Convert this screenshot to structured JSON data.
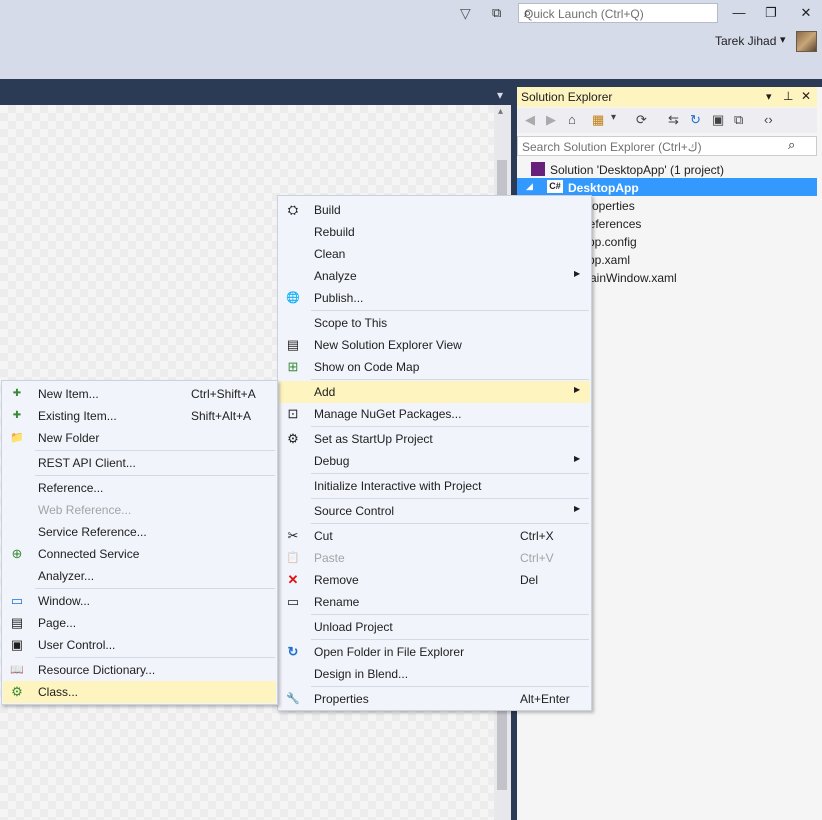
{
  "titlebar": {
    "quick_launch_placeholder": "Quick Launch (Ctrl+Q)",
    "user_name": "Tarek Jihad",
    "filter_glyph": "▽",
    "feedback_glyph": "⧉",
    "search_glyph": "⌕",
    "minimize_glyph": "—",
    "restore_glyph": "❐",
    "close_glyph": "✕",
    "dropdown_glyph": "▾"
  },
  "designer": {
    "dropdown_glyph": "▾",
    "scroll_up_glyph": "▴"
  },
  "solution_explorer": {
    "title": "Solution Explorer",
    "title_glyphs": {
      "dropdown": "▾",
      "pin": "⊥",
      "close": "✕"
    },
    "toolbar_glyphs": [
      "◀",
      "▶",
      "⌂",
      "▦",
      "▾",
      "⟳",
      "⇆",
      "↻",
      "▣",
      "⧉",
      "‹›"
    ],
    "search_placeholder": "Search Solution Explorer (Ctrl+ك)",
    "search_glyph": "⌕",
    "tree": {
      "solution": "Solution 'DesktopApp' (1 project)",
      "project": "DesktopApp",
      "project_badge": "C#",
      "expand_glyph": "◢",
      "children": [
        "Properties",
        "References",
        "App.config",
        "App.xaml",
        "MainWindow.xaml"
      ]
    }
  },
  "project_menu": {
    "items": [
      {
        "label": "Build",
        "icon": "build-icon",
        "glyph": "⛭"
      },
      {
        "label": "Rebuild"
      },
      {
        "label": "Clean"
      },
      {
        "label": "Analyze",
        "submenu": true
      },
      {
        "label": "Publish...",
        "icon": "globe-icon",
        "glyph": "🌐"
      },
      {
        "label": "Scope to This"
      },
      {
        "label": "New Solution Explorer View",
        "icon": "new-view-icon",
        "glyph": "▤"
      },
      {
        "label": "Show on Code Map",
        "icon": "code-map-icon",
        "glyph": "⊞"
      },
      {
        "label": "Add",
        "submenu": true,
        "highlighted": true
      },
      {
        "label": "Manage NuGet Packages...",
        "icon": "package-icon",
        "glyph": "⊡"
      },
      {
        "label": "Set as StartUp Project",
        "icon": "gear-icon",
        "glyph": "⚙"
      },
      {
        "label": "Debug",
        "submenu": true
      },
      {
        "label": "Initialize Interactive with Project"
      },
      {
        "label": "Source Control",
        "submenu": true
      },
      {
        "label": "Cut",
        "shortcut": "Ctrl+X",
        "icon": "scissors-icon",
        "glyph": "✂"
      },
      {
        "label": "Paste",
        "shortcut": "Ctrl+V",
        "icon": "paste-icon",
        "glyph": "📋",
        "disabled": true
      },
      {
        "label": "Remove",
        "shortcut": "Del",
        "icon": "remove-icon",
        "glyph": "✕"
      },
      {
        "label": "Rename",
        "icon": "rename-icon",
        "glyph": "▭"
      },
      {
        "label": "Unload Project"
      },
      {
        "label": "Open Folder in File Explorer",
        "icon": "refresh-arrow-icon",
        "glyph": "↻"
      },
      {
        "label": "Design in Blend..."
      },
      {
        "label": "Properties",
        "shortcut": "Alt+Enter",
        "icon": "wrench-icon",
        "glyph": "🔧"
      }
    ],
    "arrow_glyph": "▶"
  },
  "add_menu": {
    "items": [
      {
        "label": "New Item...",
        "shortcut": "Ctrl+Shift+A",
        "icon": "new-item-icon",
        "glyph": "✚"
      },
      {
        "label": "Existing Item...",
        "shortcut": "Shift+Alt+A",
        "icon": "existing-item-icon",
        "glyph": "✚"
      },
      {
        "label": "New Folder",
        "icon": "folder-icon",
        "glyph": "📁"
      },
      {
        "label": "REST API Client..."
      },
      {
        "label": "Reference..."
      },
      {
        "label": "Web Reference...",
        "disabled": true
      },
      {
        "label": "Service Reference..."
      },
      {
        "label": "Connected Service",
        "icon": "connected-service-icon",
        "glyph": "⊕"
      },
      {
        "label": "Analyzer..."
      },
      {
        "label": "Window...",
        "icon": "window-icon",
        "glyph": "▭"
      },
      {
        "label": "Page...",
        "icon": "page-icon",
        "glyph": "▤"
      },
      {
        "label": "User Control...",
        "icon": "user-control-icon",
        "glyph": "▣"
      },
      {
        "label": "Resource Dictionary...",
        "icon": "resource-dictionary-icon",
        "glyph": "📖"
      },
      {
        "label": "Class...",
        "icon": "class-icon",
        "glyph": "⚙",
        "highlighted": true
      }
    ]
  },
  "colors": {
    "accent": "#3399ff",
    "menu_highlight": "#fdf4bf",
    "chrome": "#2b3a55",
    "titlebar": "#d6dbe9"
  }
}
